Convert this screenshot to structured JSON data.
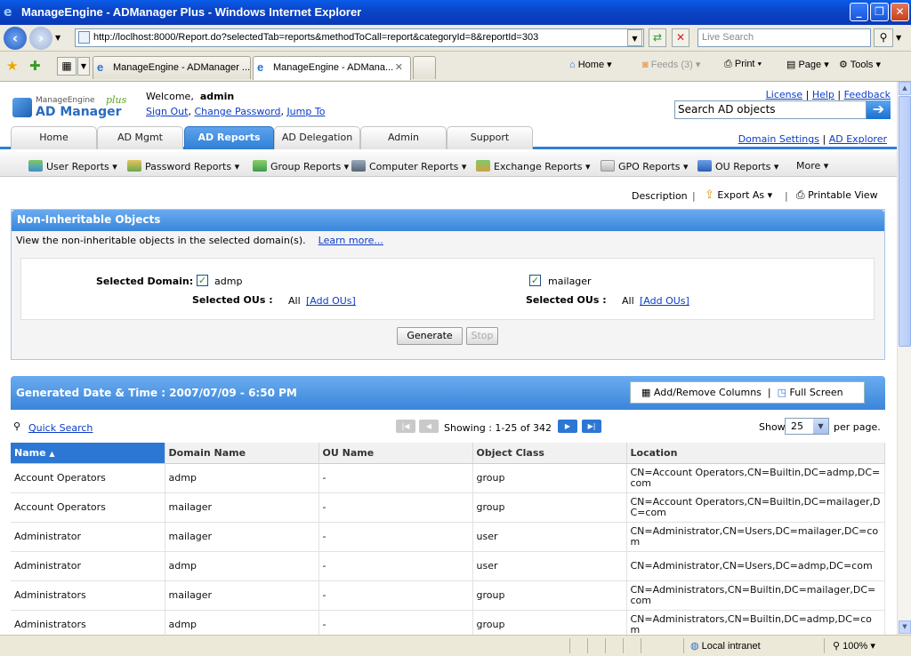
{
  "window": {
    "title": "ManageEngine - ADManager Plus - Windows Internet Explorer"
  },
  "address": {
    "url": "http://loclhost:8000/Report.do?selectedTab=reports&methodToCall=report&categoryId=8&reportId=303",
    "live_search_placeholder": "Live Search"
  },
  "ie_tabs": [
    {
      "label": "ManageEngine - ADManager ..."
    },
    {
      "label": "ManageEngine - ADMana..."
    }
  ],
  "commands": {
    "home": "Home",
    "feeds": "Feeds (3)",
    "print": "Print",
    "page": "Page",
    "tools": "Tools"
  },
  "header": {
    "logo_top": "ManageEngine",
    "logo_main": "AD Manager",
    "logo_plus": "plus",
    "welcome_label": "Welcome,",
    "username": "admin",
    "sign_out": "Sign Out",
    "change_password": "Change Password",
    "jump_to": "Jump To",
    "license": "License",
    "help": "Help",
    "feedback": "Feedback",
    "search_placeholder": "Search AD objects"
  },
  "main_tabs": [
    "Home",
    "AD Mgmt",
    "AD Reports",
    "AD Delegation",
    "Admin",
    "Support"
  ],
  "domain_links": {
    "domain_settings": "Domain Settings",
    "ad_explorer": "AD Explorer"
  },
  "sub_menu": [
    "User Reports",
    "Password Reports",
    "Group Reports",
    "Computer Reports",
    "Exchange Reports",
    "GPO Reports",
    "OU Reports",
    "More"
  ],
  "actions": {
    "description": "Description",
    "export_as": "Export As",
    "printable_view": "Printable View"
  },
  "report": {
    "title": "Non-Inheritable Objects",
    "description": "View the non-inheritable objects in the selected domain(s).",
    "learn_more": "Learn more...",
    "selected_domain_label": "Selected Domain:",
    "selected_ous_label": "Selected OUs :",
    "domains": [
      {
        "name": "admp",
        "ous": "All",
        "add_ous": "[Add OUs]"
      },
      {
        "name": "mailager",
        "ous": "All",
        "add_ous": "[Add OUs]"
      }
    ],
    "generate": "Generate",
    "stop": "Stop"
  },
  "results": {
    "generated": "Generated Date & Time : 2007/07/09 - 6:50 PM",
    "add_remove_columns": "Add/Remove Columns",
    "full_screen": "Full Screen",
    "quick_search": "Quick Search",
    "showing": "Showing : 1-25 of 342",
    "show_label": "Show",
    "show_value": "25",
    "per_page": "per page.",
    "columns": [
      "Name",
      "Domain Name",
      "OU Name",
      "Object Class",
      "Location"
    ],
    "rows": [
      [
        "Account Operators",
        "admp",
        "-",
        "group",
        "CN=Account Operators,CN=Builtin,DC=admp,DC=com"
      ],
      [
        "Account Operators",
        "mailager",
        "-",
        "group",
        "CN=Account Operators,CN=Builtin,DC=mailager,DC=com"
      ],
      [
        "Administrator",
        "mailager",
        "-",
        "user",
        "CN=Administrator,CN=Users,DC=mailager,DC=com"
      ],
      [
        "Administrator",
        "admp",
        "-",
        "user",
        "CN=Administrator,CN=Users,DC=admp,DC=com"
      ],
      [
        "Administrators",
        "mailager",
        "-",
        "group",
        "CN=Administrators,CN=Builtin,DC=mailager,DC=com"
      ],
      [
        "Administrators",
        "admp",
        "-",
        "group",
        "CN=Administrators,CN=Builtin,DC=admp,DC=com"
      ]
    ]
  },
  "status": {
    "zone": "Local intranet",
    "zoom": "100%"
  },
  "colors": {
    "accent": "#2f7fd6",
    "title_bar": "#0a46c8",
    "link": "#0b3cc8"
  }
}
